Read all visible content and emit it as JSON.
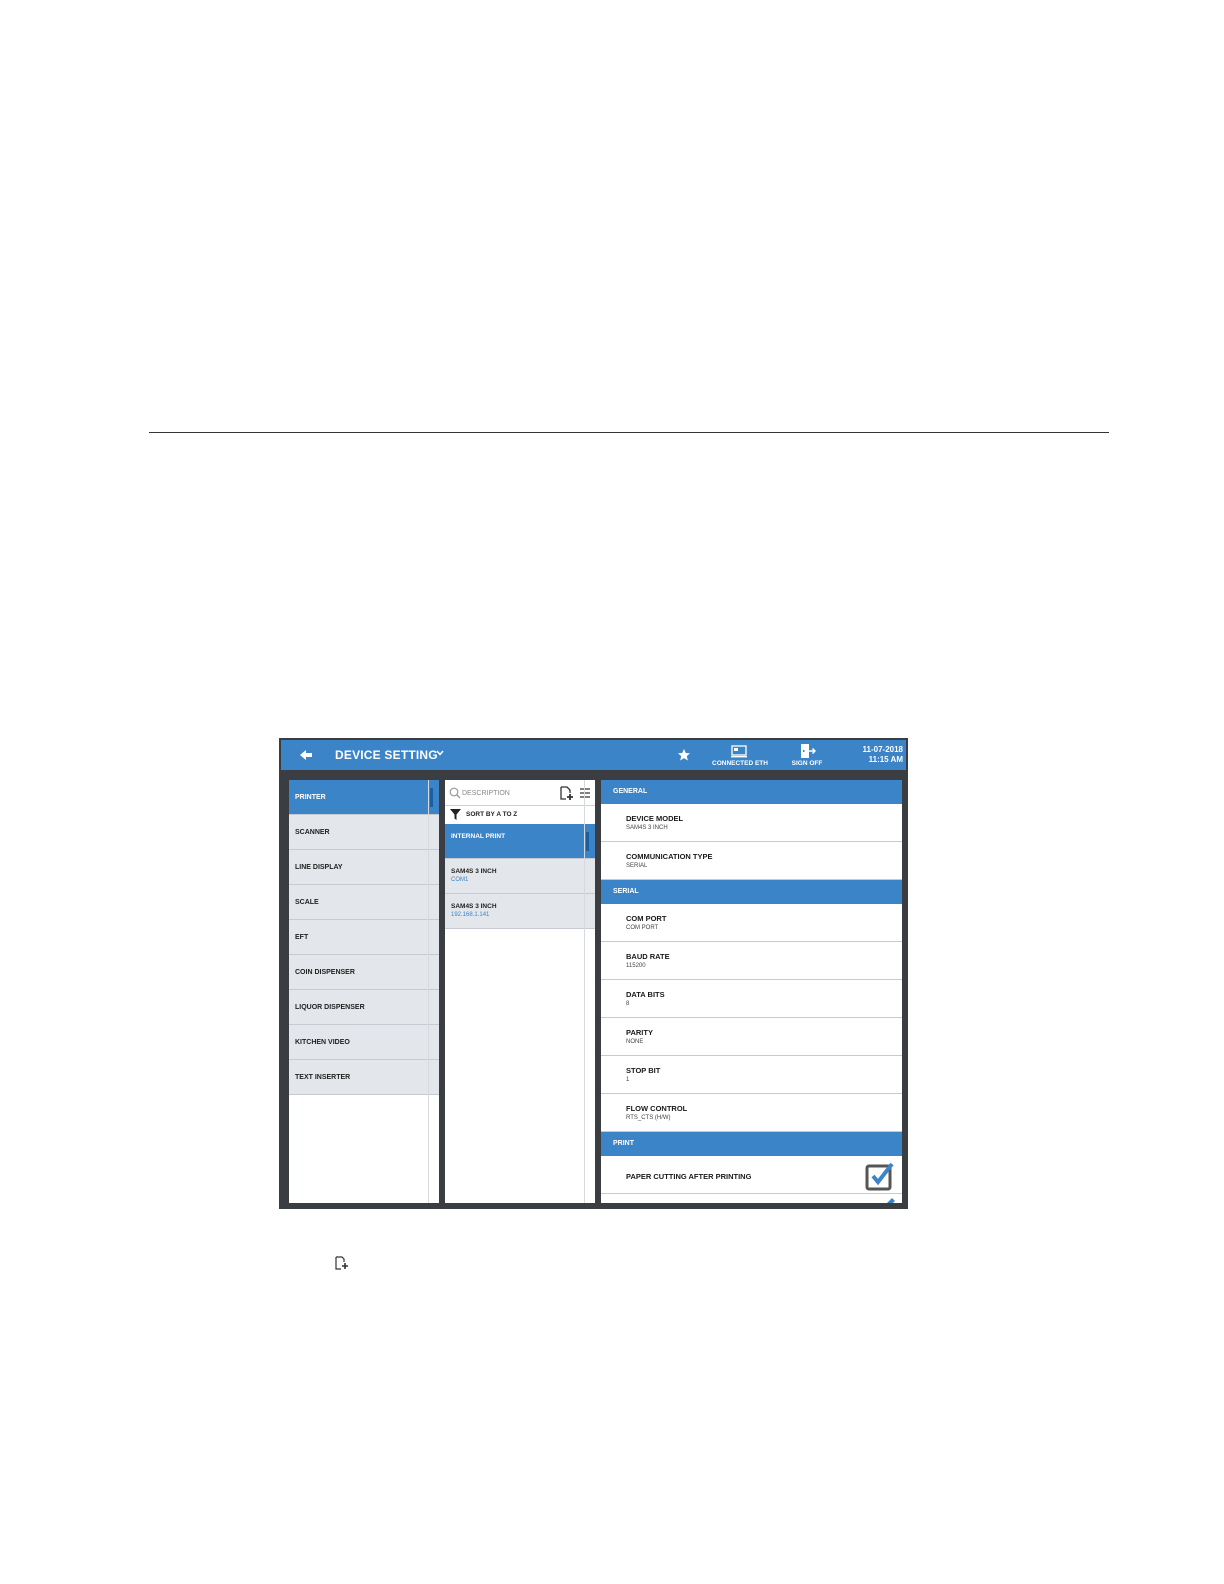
{
  "header": {
    "title": "DEVICE SETTING",
    "connection_label": "CONNECTED ETH",
    "signoff_label": "SIGN OFF",
    "date": "11-07-2018",
    "time": "11:15 AM"
  },
  "categories": [
    {
      "label": "PRINTER",
      "selected": true
    },
    {
      "label": "SCANNER"
    },
    {
      "label": "LINE DISPLAY"
    },
    {
      "label": "SCALE"
    },
    {
      "label": "EFT"
    },
    {
      "label": "COIN DISPENSER"
    },
    {
      "label": "LIQUOR DISPENSER"
    },
    {
      "label": "KITCHEN VIDEO"
    },
    {
      "label": "TEXT INSERTER"
    }
  ],
  "device_list": {
    "search_placeholder": "DESCRIPTION",
    "sort_label": "SORT BY A TO Z",
    "items": [
      {
        "name": "INTERNAL PRINT",
        "sub": "",
        "selected": true
      },
      {
        "name": "SAM4S 3 INCH",
        "sub": "COM1"
      },
      {
        "name": "SAM4S 3 INCH",
        "sub": "192.168.1.141"
      }
    ]
  },
  "settings": {
    "general": {
      "header": "GENERAL",
      "rows": [
        {
          "title": "DEVICE MODEL",
          "value": "SAM4S 3 INCH"
        },
        {
          "title": "COMMUNICATION TYPE",
          "value": "SERIAL"
        }
      ]
    },
    "serial": {
      "header": "SERIAL",
      "rows": [
        {
          "title": "COM PORT",
          "value": "COM PORT"
        },
        {
          "title": "BAUD RATE",
          "value": "115200"
        },
        {
          "title": "DATA BITS",
          "value": "8"
        },
        {
          "title": "PARITY",
          "value": "NONE"
        },
        {
          "title": "STOP BIT",
          "value": "1"
        },
        {
          "title": "FLOW CONTROL",
          "value": "RTS_CTS (H/W)"
        }
      ]
    },
    "print": {
      "header": "PRINT",
      "rows": [
        {
          "title": "PAPER CUTTING AFTER PRINTING",
          "checked": true
        }
      ]
    }
  },
  "colors": {
    "accent": "#3b84c8",
    "frame": "#3a3d42",
    "list_bg": "#e3e6ea"
  }
}
